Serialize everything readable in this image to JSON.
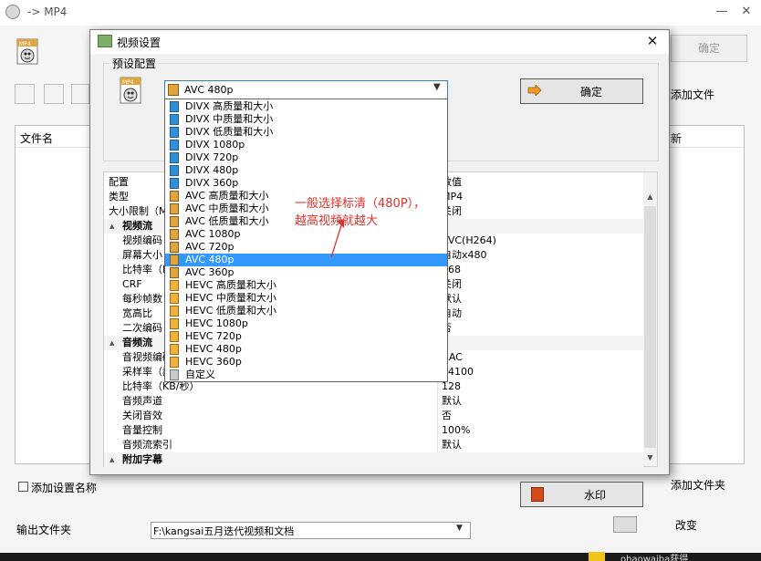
{
  "main_window": {
    "title": "-> MP4",
    "ok_label": "确定",
    "add_file_label": "添加文件",
    "add_folder_label": "添加文件夹",
    "change_label": "改变",
    "list_header_name": "文件名",
    "list_header_right": "新",
    "add_setting_name_label": "添加设置名称",
    "output_folder_label": "输出文件夹",
    "output_folder_value": "F:\\kangsai五月迭代视频和文档",
    "minimize_glyph": "—",
    "close_glyph": "✕",
    "taskbar_text": "ohaowaiba获得"
  },
  "dialog": {
    "title": "视频设置",
    "close_glyph": "✕",
    "preset_group_label": "预设配置",
    "preset_selected": "AVC 480p",
    "ok_label": "确定",
    "watermark_label": "水印",
    "grid_header_key": "配置",
    "grid_header_val": "数值",
    "grid_rows": [
      {
        "key": "类型",
        "val": "MP4",
        "level": 0
      },
      {
        "key": "大小限制（MB）",
        "val": "关闭",
        "level": 0
      },
      {
        "key": "视频流",
        "val": "",
        "category": true
      },
      {
        "key": "视频编码",
        "val": "AVC(H264)",
        "level": 1
      },
      {
        "key": "屏幕大小",
        "val": "自动x480",
        "level": 1
      },
      {
        "key": "比特率（KB/秒）",
        "val": "768",
        "level": 1
      },
      {
        "key": "CRF",
        "val": "关闭",
        "level": 1
      },
      {
        "key": "每秒帧数",
        "val": "默认",
        "level": 1
      },
      {
        "key": "宽高比",
        "val": "自动",
        "level": 1
      },
      {
        "key": "二次编码",
        "val": "否",
        "level": 1
      },
      {
        "key": "音频流",
        "val": "",
        "category": true
      },
      {
        "key": "音视频编码",
        "val": "AAC",
        "level": 1
      },
      {
        "key": "采样率（赫兹）",
        "val": "44100",
        "level": 1
      },
      {
        "key": "比特率（KB/秒）",
        "val": "128",
        "level": 1
      },
      {
        "key": "音频声道",
        "val": "默认",
        "level": 1
      },
      {
        "key": "关闭音效",
        "val": "否",
        "level": 1
      },
      {
        "key": "音量控制",
        "val": "100%",
        "level": 1
      },
      {
        "key": "音频流索引",
        "val": "默认",
        "level": 1
      },
      {
        "key": "附加字幕",
        "val": "",
        "category": true
      }
    ]
  },
  "dropdown": {
    "items": [
      {
        "label": "DIVX 高质量和大小",
        "icon": "divx-icon"
      },
      {
        "label": "DIVX 中质量和大小",
        "icon": "divx-icon"
      },
      {
        "label": "DIVX 低质量和大小",
        "icon": "divx-icon"
      },
      {
        "label": "DIVX 1080p",
        "icon": "divx-icon"
      },
      {
        "label": "DIVX 720p",
        "icon": "divx-icon"
      },
      {
        "label": "DIVX 480p",
        "icon": "divx-icon"
      },
      {
        "label": "DIVX 360p",
        "icon": "divx-icon"
      },
      {
        "label": "AVC 高质量和大小",
        "icon": "avc-icon"
      },
      {
        "label": "AVC 中质量和大小",
        "icon": "avc-icon"
      },
      {
        "label": "AVC 低质量和大小",
        "icon": "avc-icon"
      },
      {
        "label": "AVC 1080p",
        "icon": "avc-icon"
      },
      {
        "label": "AVC 720p",
        "icon": "avc-icon"
      },
      {
        "label": "AVC 480p",
        "icon": "avc-icon",
        "selected": true
      },
      {
        "label": "AVC 360p",
        "icon": "avc-icon"
      },
      {
        "label": "HEVC 高质量和大小",
        "icon": "hevc-icon"
      },
      {
        "label": "HEVC 中质量和大小",
        "icon": "hevc-icon"
      },
      {
        "label": "HEVC 低质量和大小",
        "icon": "hevc-icon"
      },
      {
        "label": "HEVC 1080p",
        "icon": "hevc-icon"
      },
      {
        "label": "HEVC 720p",
        "icon": "hevc-icon"
      },
      {
        "label": "HEVC 480p",
        "icon": "hevc-icon"
      },
      {
        "label": "HEVC 360p",
        "icon": "hevc-icon"
      },
      {
        "label": "自定义",
        "icon": "custom-icon"
      }
    ]
  },
  "annotation": {
    "line1": "一般选择标清（480P），",
    "line2": "越高视频就越大",
    "color": "#e0322c"
  },
  "colors": {
    "selection": "#3399ff",
    "accent_border": "#3c7fb1"
  }
}
